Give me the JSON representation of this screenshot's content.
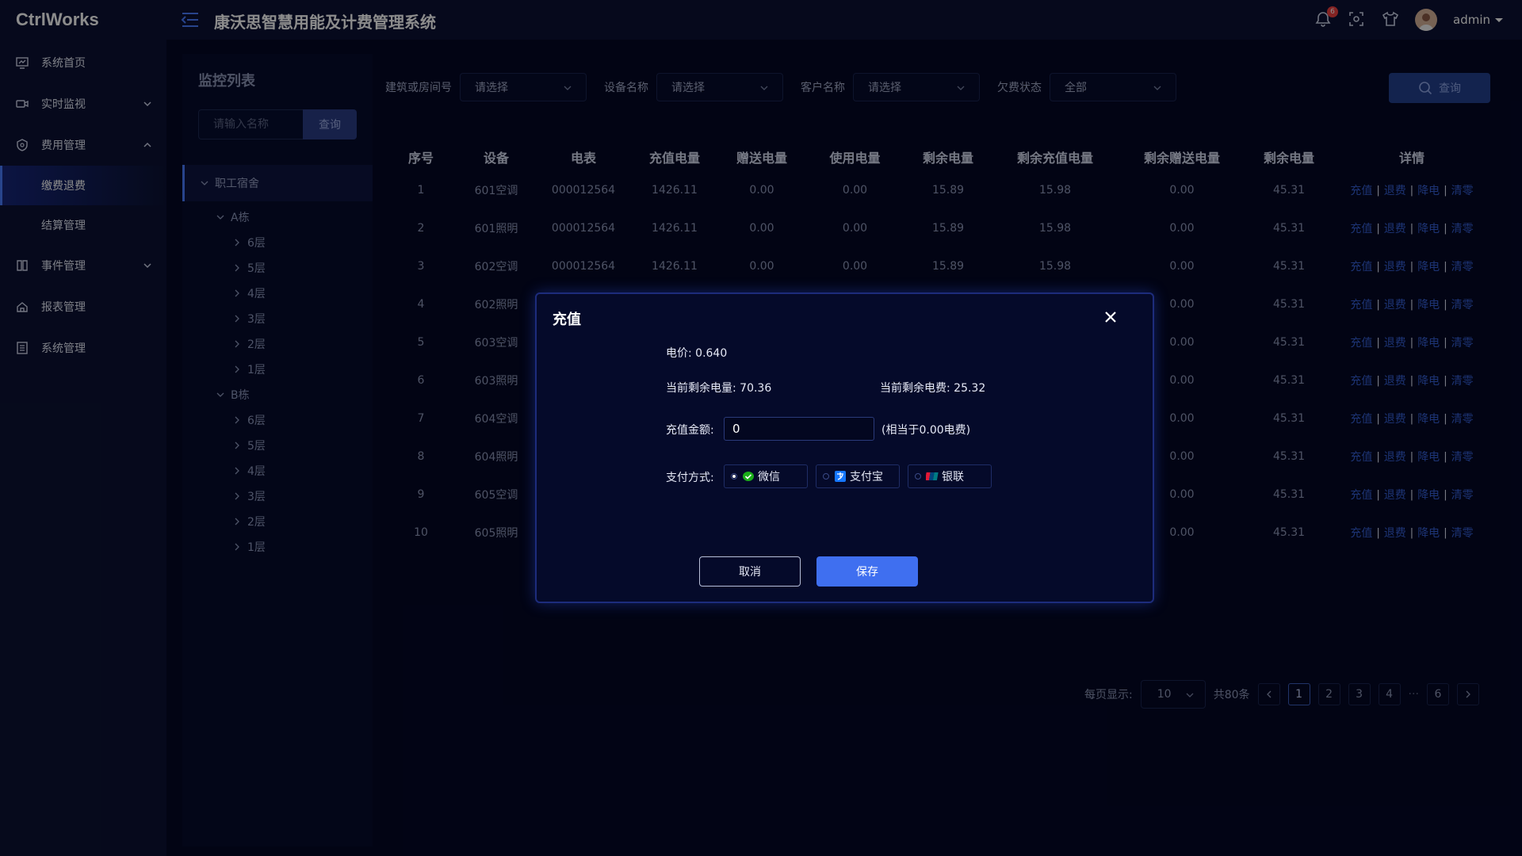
{
  "header": {
    "logo": "CtrlWorks",
    "title": "康沃思智慧用能及计费管理系统",
    "notification_count": "6",
    "user": "admin"
  },
  "sidebar": {
    "items": [
      {
        "label": "系统首页",
        "icon": "dashboard-icon"
      },
      {
        "label": "实时监视",
        "icon": "monitor-icon"
      },
      {
        "label": "费用管理",
        "icon": "shield-icon"
      },
      {
        "label": "事件管理",
        "icon": "book-icon"
      },
      {
        "label": "报表管理",
        "icon": "home-icon"
      },
      {
        "label": "系统管理",
        "icon": "list-icon"
      }
    ],
    "sub_items": [
      "缴费退费",
      "结算管理"
    ]
  },
  "tree_panel": {
    "title": "监控列表",
    "search_placeholder": "请输入名称",
    "search_button": "查询",
    "root": "职工宿舍",
    "buildings": [
      {
        "name": "A栋",
        "floors": [
          "6层",
          "5层",
          "4层",
          "3层",
          "2层",
          "1层"
        ]
      },
      {
        "name": "B栋",
        "floors": [
          "6层",
          "5层",
          "4层",
          "3层",
          "2层",
          "1层"
        ]
      }
    ]
  },
  "filters": {
    "building_label": "建筑或房间号",
    "building_value": "请选择",
    "device_label": "设备名称",
    "device_value": "请选择",
    "customer_label": "客户名称",
    "customer_value": "请选择",
    "arrears_label": "欠费状态",
    "arrears_value": "全部",
    "query_button": "查询"
  },
  "table": {
    "headers": [
      "序号",
      "设备",
      "电表",
      "充值电量",
      "赠送电量",
      "使用电量",
      "剩余电量",
      "剩余充值电量",
      "剩余赠送电量",
      "剩余电量",
      "详情"
    ],
    "rows": [
      [
        "1",
        "601空调",
        "000012564",
        "1426.11",
        "0.00",
        "0.00",
        "15.89",
        "15.98",
        "0.00",
        "45.31"
      ],
      [
        "2",
        "601照明",
        "000012564",
        "1426.11",
        "0.00",
        "0.00",
        "15.89",
        "15.98",
        "0.00",
        "45.31"
      ],
      [
        "3",
        "602空调",
        "000012564",
        "1426.11",
        "0.00",
        "0.00",
        "15.89",
        "15.98",
        "0.00",
        "45.31"
      ],
      [
        "4",
        "602照明",
        "",
        "",
        "",
        "",
        "",
        "",
        "0.00",
        "45.31"
      ],
      [
        "5",
        "603空调",
        "",
        "",
        "",
        "",
        "",
        "",
        "0.00",
        "45.31"
      ],
      [
        "6",
        "603照明",
        "",
        "",
        "",
        "",
        "",
        "",
        "0.00",
        "45.31"
      ],
      [
        "7",
        "604空调",
        "",
        "",
        "",
        "",
        "",
        "",
        "0.00",
        "45.31"
      ],
      [
        "8",
        "604照明",
        "",
        "",
        "",
        "",
        "",
        "",
        "0.00",
        "45.31"
      ],
      [
        "9",
        "605空调",
        "",
        "",
        "",
        "",
        "",
        "",
        "0.00",
        "45.31"
      ],
      [
        "10",
        "605照明",
        "",
        "",
        "",
        "",
        "",
        "",
        "0.00",
        "45.31"
      ]
    ],
    "actions": [
      "充值",
      "退费",
      "降电",
      "清零"
    ]
  },
  "pager": {
    "per_page_label": "每页显示:",
    "per_page_value": "10",
    "total": "共80条",
    "pages": [
      "1",
      "2",
      "3",
      "4",
      "6"
    ],
    "ellipsis": "···",
    "current": "1"
  },
  "modal": {
    "title": "充值",
    "price": "电价: 0.640",
    "remaining_power": "当前剩余电量: 70.36",
    "remaining_fee": "当前剩余电费: 25.32",
    "amount_label": "充值金额:",
    "amount_value": "0",
    "amount_hint": "(相当于0.00电费)",
    "pay_label": "支付方式:",
    "pay_methods": [
      "微信",
      "支付宝",
      "银联"
    ],
    "cancel": "取消",
    "save": "保存"
  }
}
